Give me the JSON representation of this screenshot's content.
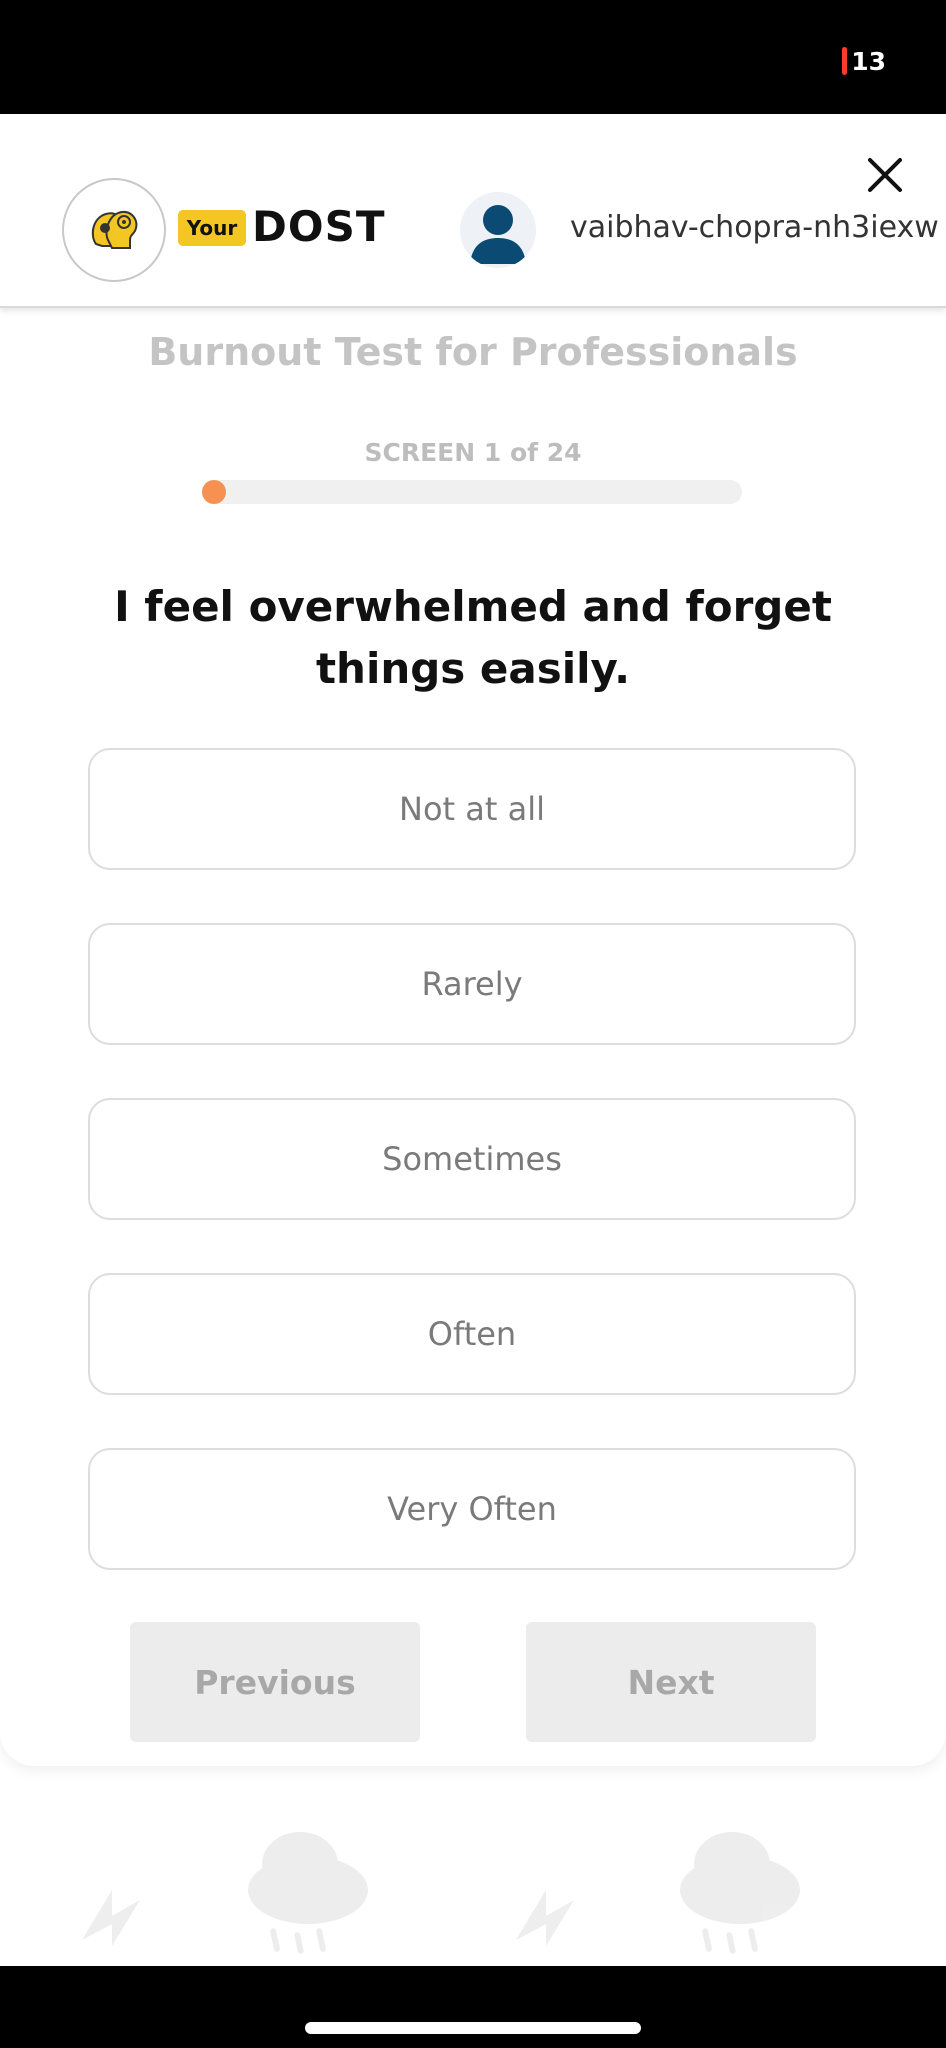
{
  "status_bar": {
    "battery_level": "13"
  },
  "header": {
    "logo_your": "Your",
    "logo_dost": "DOST",
    "username": "vaibhav-chopra-nh3iexw"
  },
  "test": {
    "title": "Burnout Test for Professionals",
    "screen_label": "SCREEN 1 of 24",
    "progress_fraction": 0.0417,
    "question": "I feel overwhelmed and forget things easily."
  },
  "options": [
    {
      "label": "Not at all"
    },
    {
      "label": "Rarely"
    },
    {
      "label": "Sometimes"
    },
    {
      "label": "Often"
    },
    {
      "label": "Very Often"
    }
  ],
  "navigation": {
    "previous_label": "Previous",
    "next_label": "Next"
  },
  "colors": {
    "accent": "#f79152",
    "brand_yellow": "#f3c623",
    "avatar_blue": "#0b4a72"
  }
}
